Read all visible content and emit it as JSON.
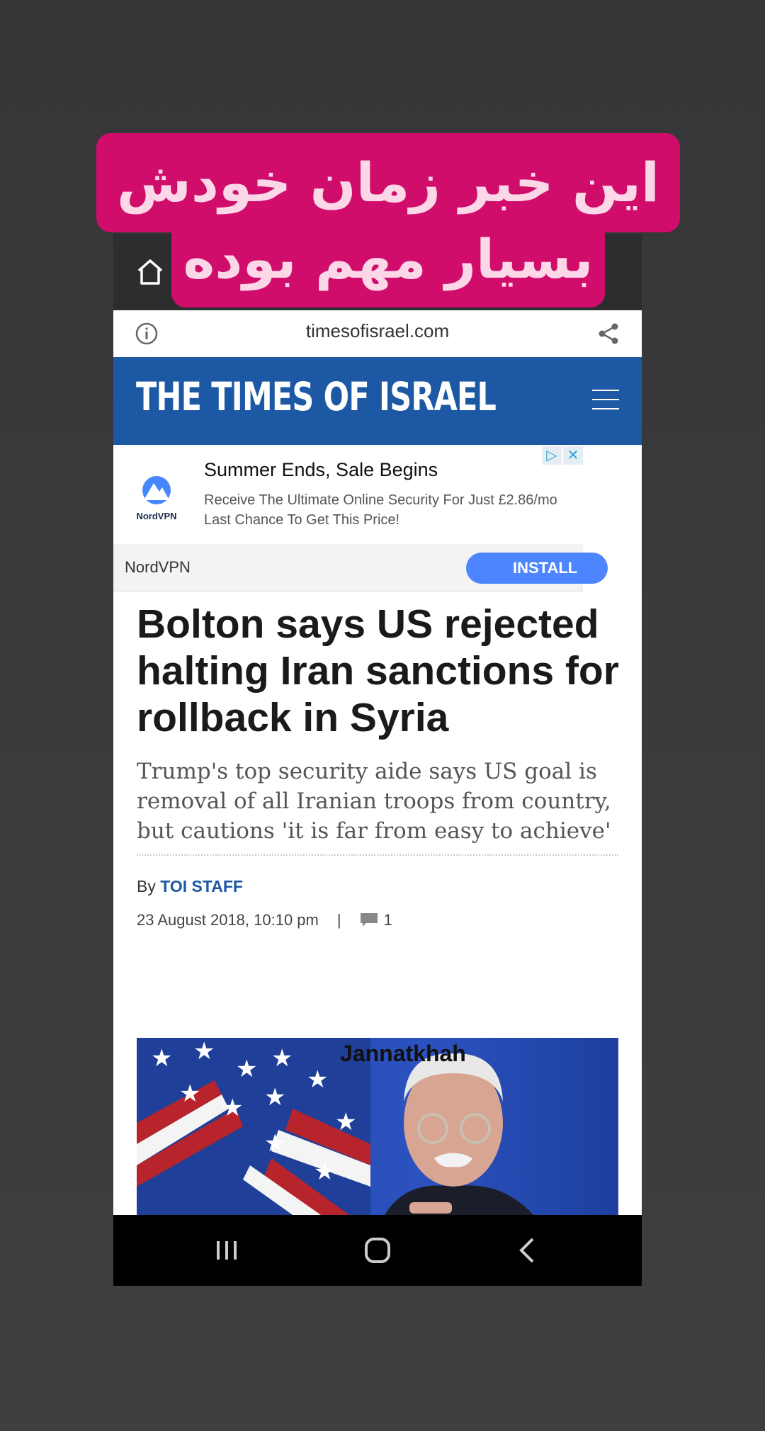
{
  "overlay": {
    "line1": "این خبر زمان خودش",
    "line2": "بسیار مهم بوده"
  },
  "browser": {
    "url": "timesofisrael.com"
  },
  "site": {
    "logo": "THE TIMES OF ISRAEL"
  },
  "ad": {
    "logo_text": "NordVPN",
    "title": "Summer Ends, Sale Begins",
    "desc_line1": "Receive The Ultimate Online Security For Just £2.86/mo",
    "desc_line2": "Last Chance To Get This Price!",
    "brand": "NordVPN",
    "install_label": "INSTALL"
  },
  "article": {
    "headline": "Bolton says US rejected halting Iran sanctions for rollback in Syria",
    "subhead": "Trump's top security aide says US goal is removal of all Iranian troops from country, but cautions 'it is far from easy to achieve'",
    "by_prefix": "By",
    "author": "TOI STAFF",
    "date": "23 August 2018, 10:10 pm",
    "separator": "|",
    "comment_count": "1",
    "photo_credit": "Jannatkhah"
  },
  "colors": {
    "brand_blue": "#1d58a5",
    "overlay_pink": "#d10d6b",
    "install_blue": "#4d85ff"
  },
  "icons": [
    "home-icon",
    "info-icon",
    "share-icon",
    "menu-icon",
    "adchoices-icon",
    "close-icon",
    "nordvpn-logo-icon",
    "comment-icon",
    "recent-apps-icon",
    "home-nav-icon",
    "back-icon"
  ]
}
